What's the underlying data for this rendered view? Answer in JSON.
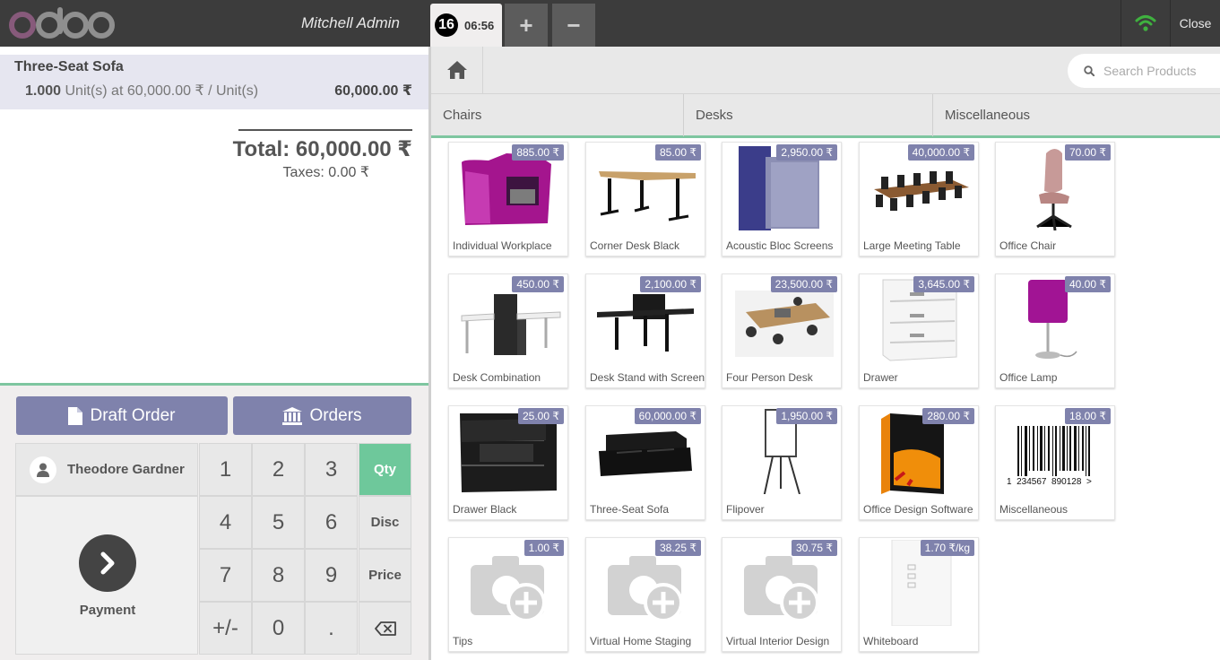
{
  "header": {
    "logo_text": "odoo",
    "cashier": "Mitchell Admin",
    "order_number": "16",
    "order_time": "06:56",
    "add_order_label": "+",
    "remove_order_label": "−",
    "close_label": "Close"
  },
  "order": {
    "lines": [
      {
        "name": "Three-Seat Sofa",
        "qty": "1.000",
        "unit_text": "Unit(s) at 60,000.00 ₹ / Unit(s)",
        "price": "60,000.00 ₹"
      }
    ],
    "total": "Total: 60,000.00 ₹",
    "taxes": "Taxes: 0.00 ₹"
  },
  "controls": {
    "draft_order": "Draft Order",
    "orders": "Orders",
    "customer": "Theodore Gardner",
    "payment": "Payment"
  },
  "numpad": {
    "keys": [
      "1",
      "2",
      "3",
      "4",
      "5",
      "6",
      "7",
      "8",
      "9",
      "+/-",
      "0",
      "."
    ],
    "modes": [
      "Qty",
      "Disc",
      "Price"
    ],
    "active_mode": "Qty"
  },
  "search": {
    "placeholder": "Search Products"
  },
  "categories": [
    "Chairs",
    "Desks",
    "Miscellaneous"
  ],
  "products": [
    {
      "name": "Individual Workplace",
      "price": "885.00 ₹",
      "icon": "pod-icon"
    },
    {
      "name": "Corner Desk Black",
      "price": "85.00 ₹",
      "icon": "desk-icon"
    },
    {
      "name": "Acoustic Bloc Screens",
      "price": "2,950.00 ₹",
      "icon": "screens-icon"
    },
    {
      "name": "Large Meeting Table",
      "price": "40,000.00 ₹",
      "icon": "meeting-table-icon"
    },
    {
      "name": "Office Chair",
      "price": "70.00 ₹",
      "icon": "chair-icon"
    },
    {
      "name": "Desk Combination",
      "price": "450.00 ₹",
      "icon": "desk-combo-icon"
    },
    {
      "name": "Desk Stand with Screen",
      "price": "2,100.00 ₹",
      "icon": "desk-stand-icon"
    },
    {
      "name": "Four Person Desk",
      "price": "23,500.00 ₹",
      "icon": "four-desk-icon"
    },
    {
      "name": "Drawer",
      "price": "3,645.00 ₹",
      "icon": "drawer-icon"
    },
    {
      "name": "Office Lamp",
      "price": "40.00 ₹",
      "icon": "lamp-icon"
    },
    {
      "name": "Drawer Black",
      "price": "25.00 ₹",
      "icon": "drawer-black-icon"
    },
    {
      "name": "Three-Seat Sofa",
      "price": "60,000.00 ₹",
      "icon": "sofa-icon"
    },
    {
      "name": "Flipover",
      "price": "1,950.00 ₹",
      "icon": "flipover-icon"
    },
    {
      "name": "Office Design Software",
      "price": "280.00 ₹",
      "icon": "software-box-icon"
    },
    {
      "name": "Miscellaneous",
      "price": "18.00 ₹",
      "icon": "barcode-icon",
      "barcode_text": "1  234567  890128  >"
    },
    {
      "name": "Tips",
      "price": "1.00 ₹",
      "icon": "placeholder-camera-icon"
    },
    {
      "name": "Virtual Home Staging",
      "price": "38.25 ₹",
      "icon": "placeholder-camera-icon"
    },
    {
      "name": "Virtual Interior Design",
      "price": "30.75 ₹",
      "icon": "placeholder-camera-icon"
    },
    {
      "name": "Whiteboard",
      "price": "1.70 ₹/kg",
      "icon": "whiteboard-icon"
    }
  ],
  "colors": {
    "accent": "#7f82ac",
    "active": "#6ec89b",
    "brand": "#875a7b",
    "topbar": "#3c3c3c"
  }
}
